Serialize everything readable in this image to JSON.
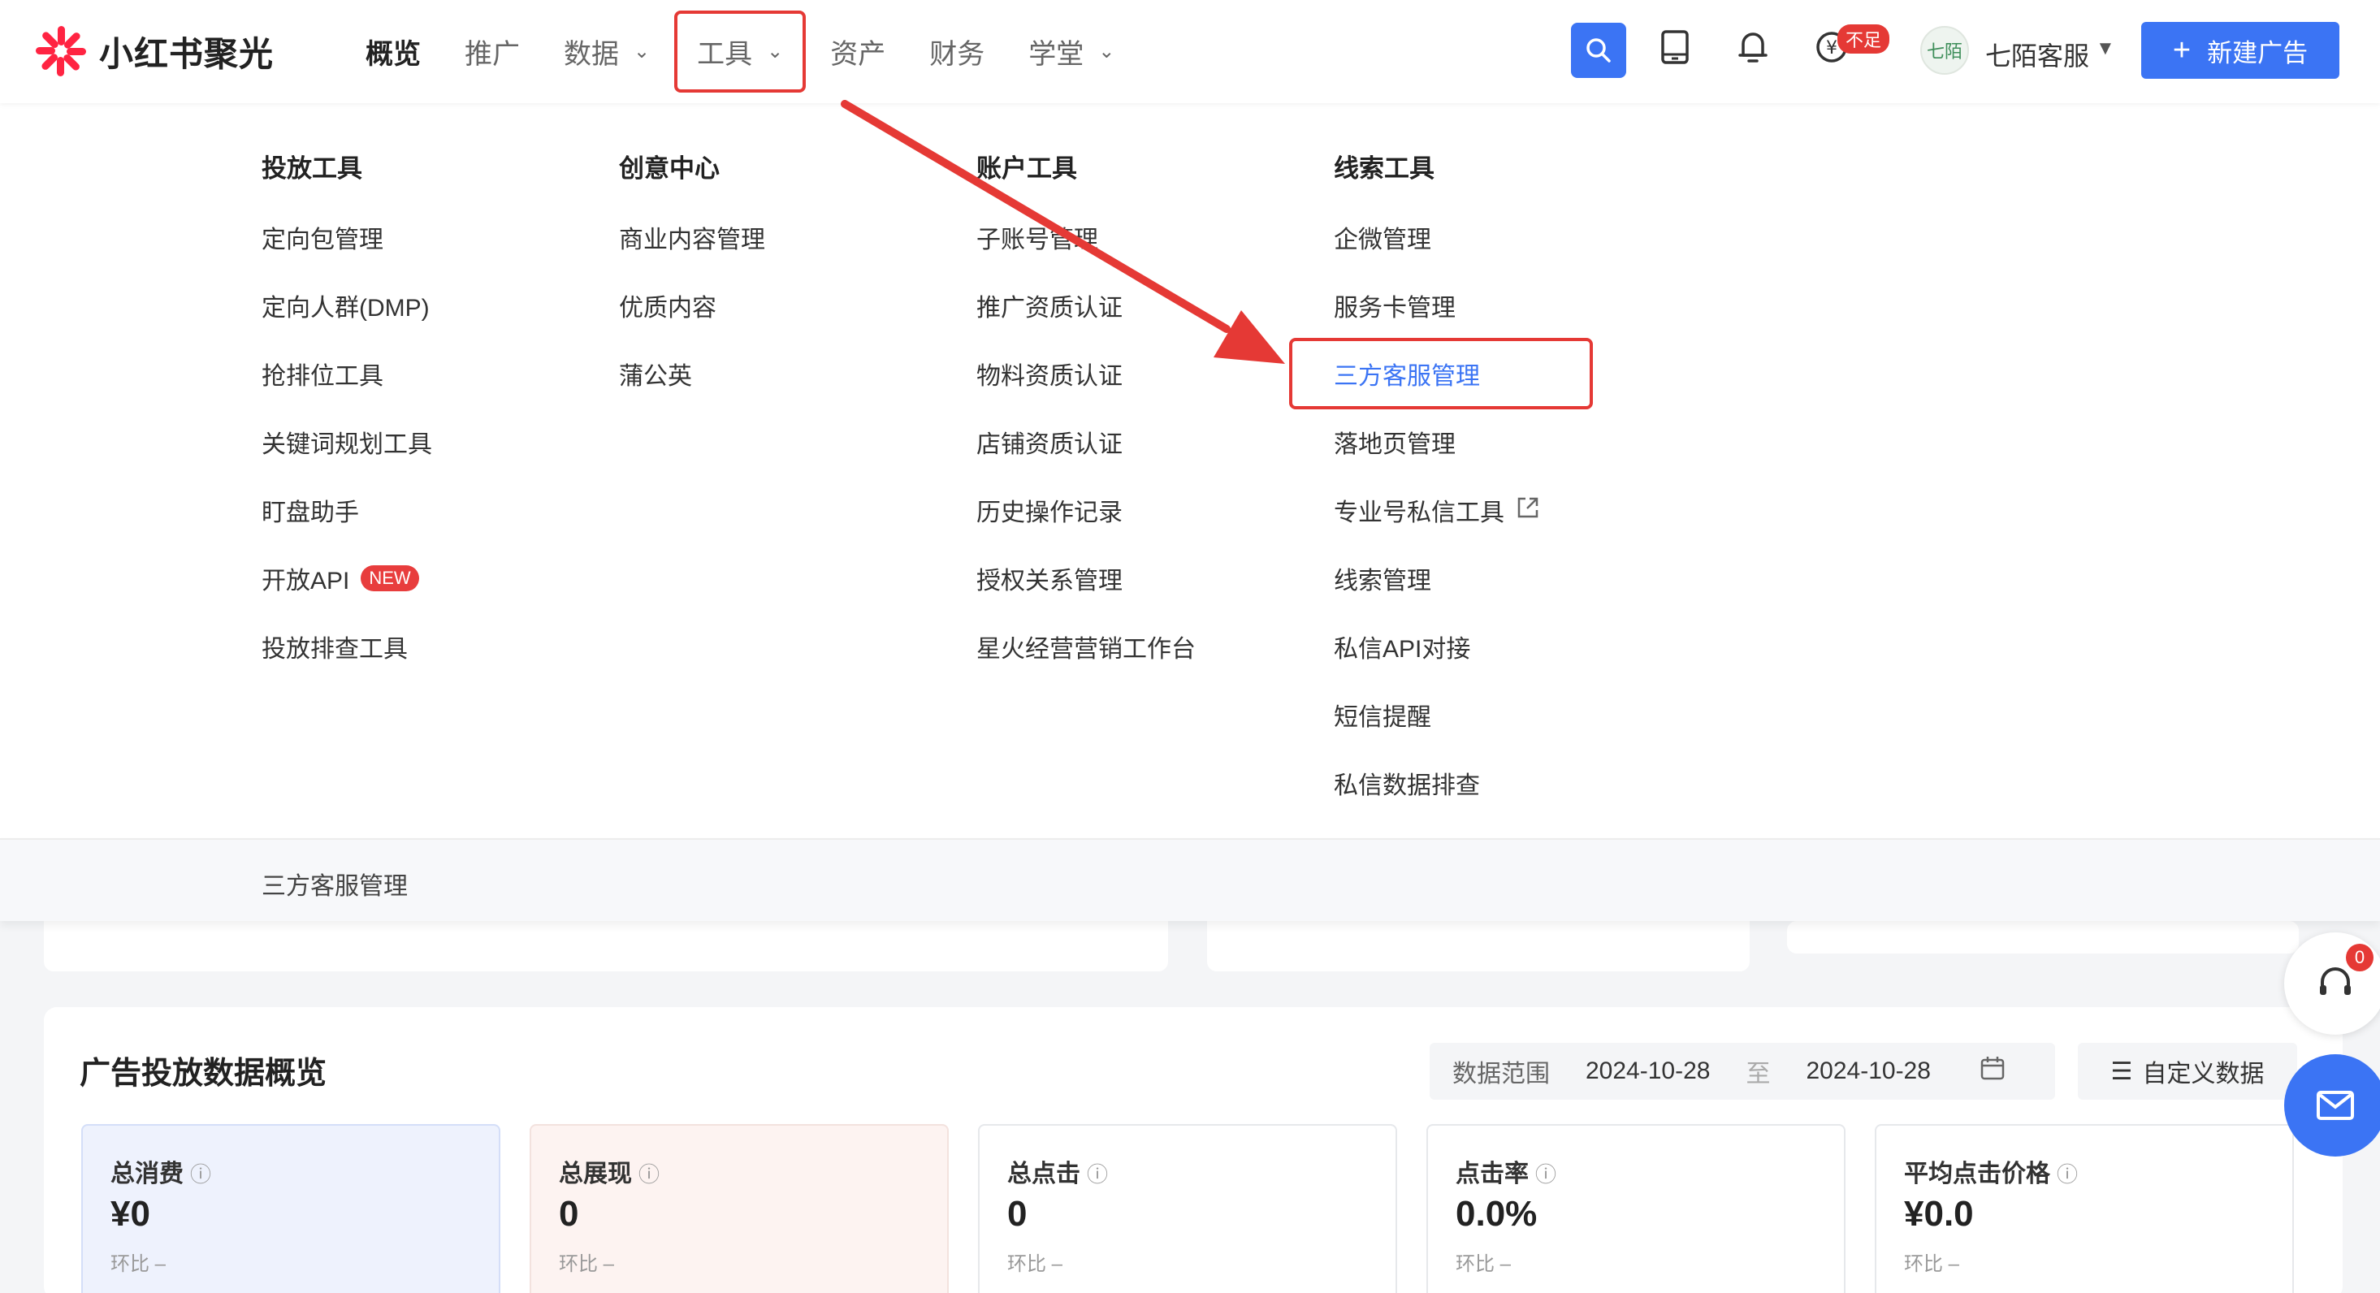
{
  "brand": {
    "name": "小红书聚光"
  },
  "nav": {
    "items": [
      {
        "label": "概览",
        "active": true
      },
      {
        "label": "推广"
      },
      {
        "label": "数据",
        "dropdown": true
      },
      {
        "label": "工具",
        "dropdown": true,
        "highlighted": true
      },
      {
        "label": "资产"
      },
      {
        "label": "财务"
      },
      {
        "label": "学堂",
        "dropdown": true
      }
    ]
  },
  "header": {
    "balance_badge": "不足",
    "account_name": "七陌客服",
    "avatar_text": "七陌",
    "new_ad_button": "新建广告",
    "icons": [
      "search-icon",
      "tablet-icon",
      "bell-icon",
      "coin-icon"
    ]
  },
  "tools_menu": {
    "columns": [
      {
        "title": "投放工具",
        "items": [
          "定向包管理",
          "定向人群(DMP)",
          "抢排位工具",
          "关键词规划工具",
          "盯盘助手",
          "开放API",
          "投放排查工具"
        ],
        "new_tag": "NEW"
      },
      {
        "title": "创意中心",
        "items": [
          "商业内容管理",
          "优质内容",
          "蒲公英"
        ]
      },
      {
        "title": "账户工具",
        "items": [
          "子账号管理",
          "推广资质认证",
          "物料资质认证",
          "店铺资质认证",
          "历史操作记录",
          "授权关系管理",
          "星火经营营销工作台"
        ]
      },
      {
        "title": "线索工具",
        "items": [
          "企微管理",
          "服务卡管理",
          "三方客服管理",
          "落地页管理",
          "专业号私信工具",
          "线索管理",
          "私信API对接",
          "短信提醒",
          "私信数据排查"
        ]
      }
    ],
    "recent": "三方客服管理"
  },
  "overview": {
    "title": "广告投放数据概览",
    "range_label": "数据范围",
    "range_start": "2024-10-28",
    "range_sep": "至",
    "range_end": "2024-10-28",
    "custom_button": "自定义数据",
    "metrics": [
      {
        "label": "总消费",
        "value": "¥0",
        "compare": "环比 –"
      },
      {
        "label": "总展现",
        "value": "0",
        "compare": "环比 –"
      },
      {
        "label": "总点击",
        "value": "0",
        "compare": "环比 –"
      },
      {
        "label": "点击率",
        "value": "0.0%",
        "compare": "环比 –"
      },
      {
        "label": "平均点击价格",
        "value": "¥0.0",
        "compare": "环比 –"
      }
    ]
  },
  "floating": {
    "cs_badge": "0"
  },
  "colors": {
    "primary": "#3b74f4",
    "annotation_red": "#e53935",
    "new_tag": "#e83d3d"
  }
}
